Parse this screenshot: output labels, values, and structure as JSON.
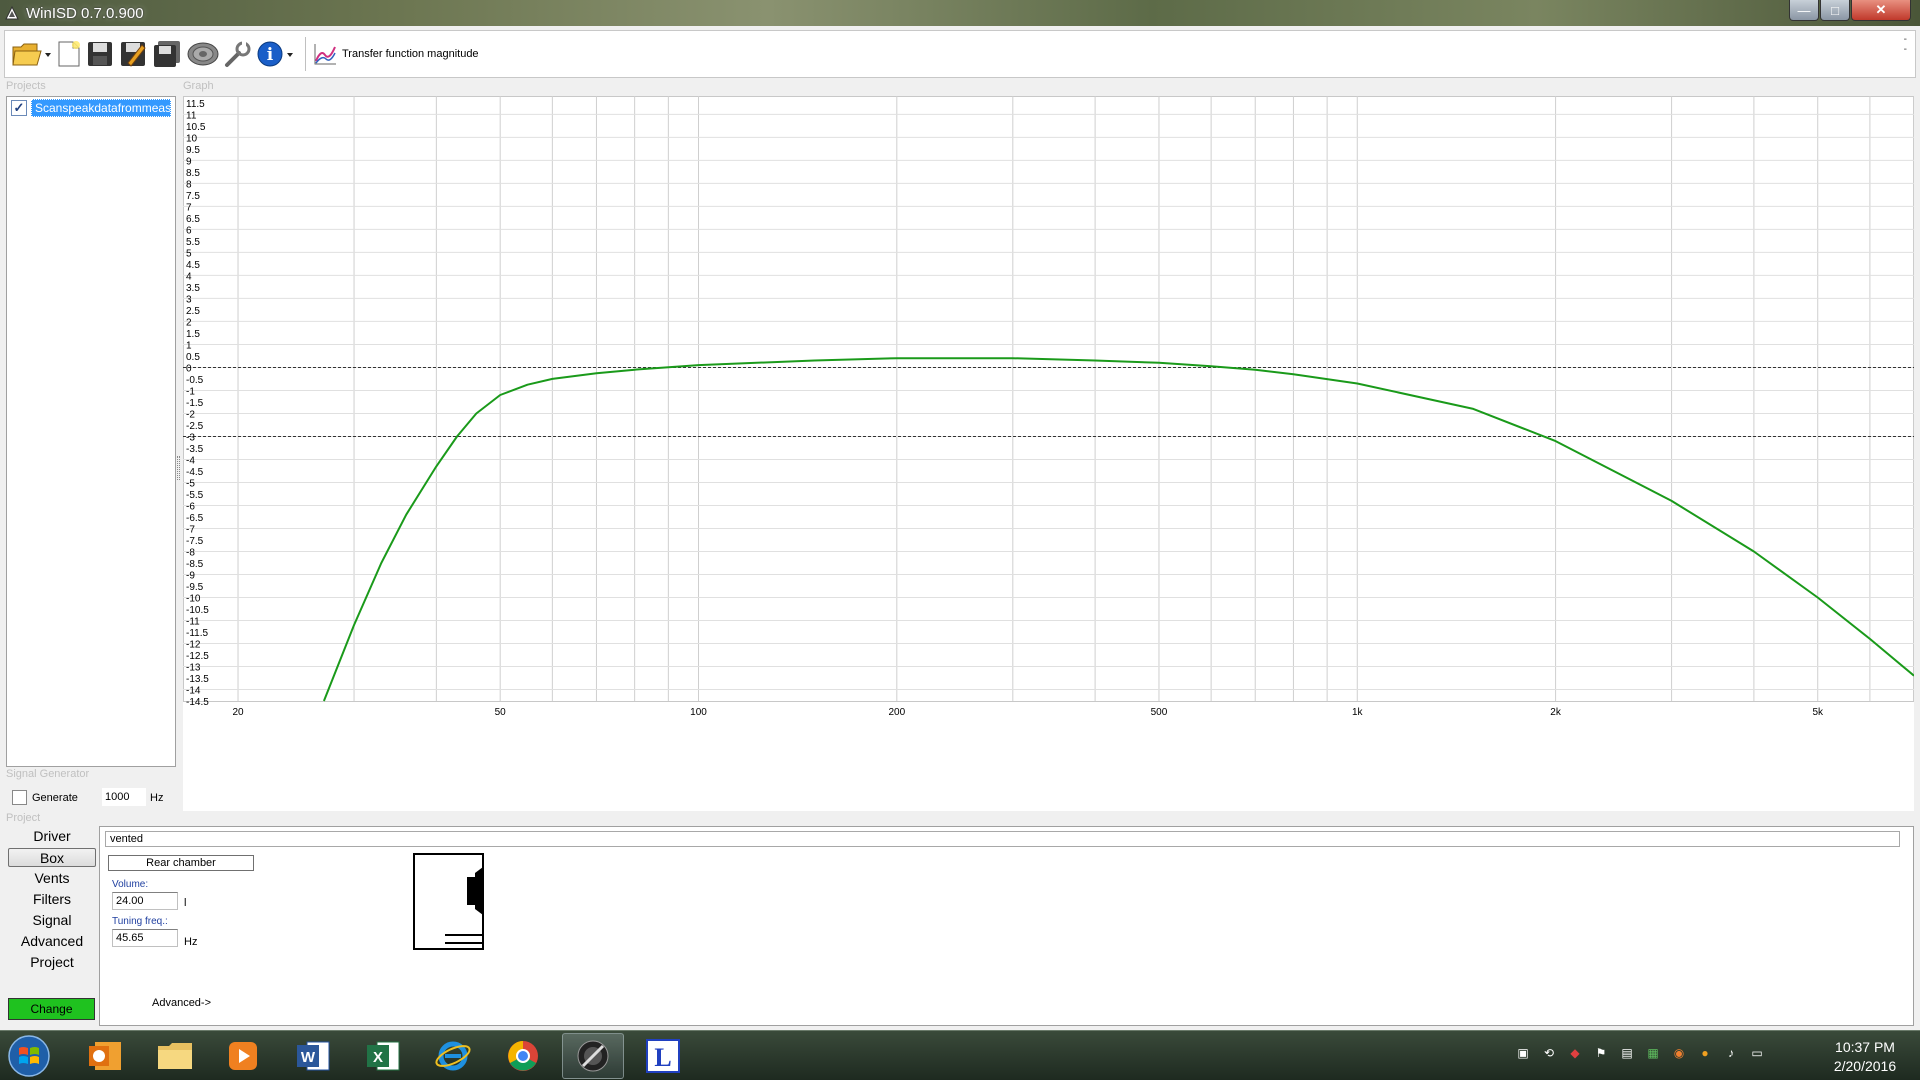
{
  "window": {
    "title": "WinISD 0.7.0.900",
    "min": "—",
    "max": "□",
    "close": "✕"
  },
  "toolbar": {
    "icons": [
      "open-folder-icon",
      "new-document-icon",
      "save-icon",
      "save-as-icon",
      "save-all-icon",
      "speaker-icon",
      "wrench-icon",
      "info-icon",
      "chart-icon"
    ],
    "tf_label": "Transfer function magnitude",
    "overflow": "-\n-"
  },
  "sections": {
    "projects": "Projects",
    "graph": "Graph",
    "signal_generator": "Signal Generator",
    "project": "Project"
  },
  "projects": {
    "items": [
      {
        "name": "Scanspeakdatafrommeas",
        "checked": true
      }
    ]
  },
  "signal_generator": {
    "generate_label": "Generate",
    "frequency": "1000",
    "unit": "Hz"
  },
  "nav": {
    "driver": "Driver",
    "box": "Box",
    "vents": "Vents",
    "filters": "Filters",
    "signal": "Signal",
    "advanced": "Advanced",
    "project": "Project",
    "change": "Change",
    "selected": "Box"
  },
  "box": {
    "type": "vented",
    "rear_chamber_label": "Rear chamber",
    "volume_label": "Volume:",
    "volume_value": "24.00",
    "volume_unit": "l",
    "tuning_label": "Tuning freq.:",
    "tuning_value": "45.65",
    "tuning_unit": "Hz",
    "advanced_label": "Advanced->"
  },
  "chart_data": {
    "type": "line",
    "xscale": "log",
    "xlim": [
      16.5,
      7000
    ],
    "ylim": [
      -14.5,
      11.8
    ],
    "y_ticks": [
      "11.5",
      "11",
      "10.5",
      "10",
      "9.5",
      "9",
      "8.5",
      "8",
      "7.5",
      "7",
      "6.5",
      "6",
      "5.5",
      "5",
      "4.5",
      "4",
      "3.5",
      "3",
      "2.5",
      "2",
      "1.5",
      "1",
      "0.5",
      "0",
      "-0.5",
      "-1",
      "-1.5",
      "-2",
      "-2.5",
      "-3",
      "-3.5",
      "-4",
      "-4.5",
      "-5",
      "-5.5",
      "-6",
      "-6.5",
      "-7",
      "-7.5",
      "-8",
      "-8.5",
      "-9",
      "-9.5",
      "-10",
      "-10.5",
      "-11",
      "-11.5",
      "-12",
      "-12.5",
      "-13",
      "-13.5",
      "-14",
      "-14.5"
    ],
    "x_ticks": [
      {
        "v": 20,
        "label": "20"
      },
      {
        "v": 50,
        "label": "50"
      },
      {
        "v": 100,
        "label": "100"
      },
      {
        "v": 200,
        "label": "200"
      },
      {
        "v": 500,
        "label": "500"
      },
      {
        "v": 1000,
        "label": "1k"
      },
      {
        "v": 2000,
        "label": "2k"
      },
      {
        "v": 5000,
        "label": "5k"
      }
    ],
    "reference_lines": [
      0,
      -3
    ],
    "grid": true,
    "series": [
      {
        "color": "#1a9a1a",
        "x": [
          27,
          30,
          33,
          36,
          40,
          43,
          46,
          50,
          55,
          60,
          70,
          80,
          100,
          150,
          200,
          300,
          400,
          500,
          600,
          700,
          800,
          1000,
          1500,
          2000,
          3000,
          4000,
          5000,
          6000,
          7000
        ],
        "y": [
          -14.5,
          -11.2,
          -8.5,
          -6.4,
          -4.3,
          -3.0,
          -2.0,
          -1.2,
          -0.75,
          -0.5,
          -0.25,
          -0.1,
          0.1,
          0.3,
          0.4,
          0.4,
          0.3,
          0.2,
          0.05,
          -0.1,
          -0.3,
          -0.7,
          -1.8,
          -3.2,
          -5.8,
          -8.0,
          -10.0,
          -11.8,
          -13.4
        ]
      }
    ]
  },
  "taskbar": {
    "apps": [
      "outlook-icon",
      "explorer-folder-icon",
      "media-player-icon",
      "word-icon",
      "excel-icon",
      "internet-explorer-icon",
      "chrome-icon",
      "winisd-icon",
      "app-l-icon"
    ],
    "active": "winisd-icon",
    "tray": [
      "tray-network-icon",
      "tray-sync-icon",
      "tray-pdf-icon",
      "tray-flag-icon",
      "tray-monitor-icon",
      "tray-app-icon",
      "tray-java-icon",
      "tray-update-icon",
      "tray-volume-icon",
      "tray-display-icon"
    ],
    "time": "10:37 PM",
    "date": "2/20/2016"
  }
}
